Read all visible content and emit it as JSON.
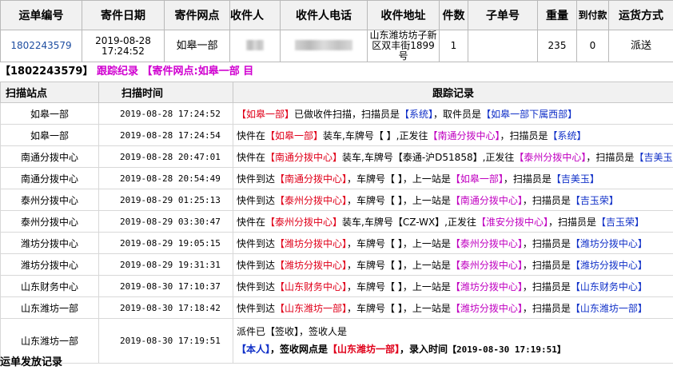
{
  "waybill": {
    "headers": [
      "运单编号",
      "寄件日期",
      "寄件网点",
      "收件人",
      "收件人电话",
      "收件地址",
      "件数",
      "子单号",
      "重量",
      "到付款",
      "运货方式"
    ],
    "row": {
      "waybill_no": "1802243579",
      "send_date": "2019-08-28",
      "send_time": "17:24:52",
      "send_site": "如皋一部",
      "address": "山东潍坊坊子新区双丰街1899号",
      "pieces": "1",
      "sub_no": "",
      "weight": "235",
      "cod": "0",
      "ship_method": "派送"
    }
  },
  "track_head": {
    "bracket_no": "【1802243579】",
    "track_link": "跟踪纪录",
    "site_label": "【寄件网点:如皋一部 目"
  },
  "track": {
    "headers": [
      "扫描站点",
      "扫描时间",
      "跟踪记录"
    ],
    "rows": [
      {
        "site": "如皋一部",
        "time": "2019-08-28 17:24:52",
        "rec": [
          [
            "r",
            "【如皋一部】"
          ],
          [
            "k",
            "已做收件扫描，扫描员是"
          ],
          [
            "b",
            "【系统】"
          ],
          [
            "k",
            "，取件员是"
          ],
          [
            "b",
            "【如皋一部下属西部】"
          ]
        ]
      },
      {
        "site": "如皋一部",
        "time": "2019-08-28 17:24:54",
        "rec": [
          [
            "k",
            "快件在"
          ],
          [
            "r",
            "【如皋一部】"
          ],
          [
            "k",
            "装车,车牌号【 】,正发往"
          ],
          [
            "p",
            "【南通分拨中心】"
          ],
          [
            "k",
            "，扫描员是"
          ],
          [
            "b",
            "【系统】"
          ]
        ]
      },
      {
        "site": "南通分拨中心",
        "time": "2019-08-28 20:47:01",
        "rec": [
          [
            "k",
            "快件在"
          ],
          [
            "r",
            "【南通分拨中心】"
          ],
          [
            "k",
            "装车,车牌号【泰通-沪D51858】,正发往"
          ],
          [
            "p",
            "【泰州分拨中心】"
          ],
          [
            "k",
            "，扫描员是"
          ],
          [
            "b",
            "【吉美玉】"
          ]
        ]
      },
      {
        "site": "南通分拨中心",
        "time": "2019-08-28 20:54:49",
        "rec": [
          [
            "k",
            "快件到达"
          ],
          [
            "r",
            "【南通分拨中心】"
          ],
          [
            "k",
            "，车牌号【 】，上一站是"
          ],
          [
            "p",
            "【如皋一部】"
          ],
          [
            "k",
            "，扫描员是"
          ],
          [
            "b",
            "【吉美玉】"
          ]
        ]
      },
      {
        "site": "泰州分拨中心",
        "time": "2019-08-29 01:25:13",
        "rec": [
          [
            "k",
            "快件到达"
          ],
          [
            "r",
            "【泰州分拨中心】"
          ],
          [
            "k",
            "，车牌号【 】，上一站是"
          ],
          [
            "p",
            "【南通分拨中心】"
          ],
          [
            "k",
            "，扫描员是"
          ],
          [
            "b",
            "【吉玉荣】"
          ]
        ]
      },
      {
        "site": "泰州分拨中心",
        "time": "2019-08-29 03:30:47",
        "rec": [
          [
            "k",
            "快件在"
          ],
          [
            "r",
            "【泰州分拨中心】"
          ],
          [
            "k",
            "装车,车牌号【CZ-WX】,正发往"
          ],
          [
            "p",
            "【淮安分拨中心】"
          ],
          [
            "k",
            "，扫描员是"
          ],
          [
            "b",
            "【吉玉荣】"
          ]
        ]
      },
      {
        "site": "潍坊分拨中心",
        "time": "2019-08-29 19:05:15",
        "rec": [
          [
            "k",
            "快件到达"
          ],
          [
            "r",
            "【潍坊分拨中心】"
          ],
          [
            "k",
            "，车牌号【 】，上一站是"
          ],
          [
            "p",
            "【泰州分拨中心】"
          ],
          [
            "k",
            "，扫描员是"
          ],
          [
            "b",
            "【潍坊分拨中心】"
          ]
        ]
      },
      {
        "site": "潍坊分拨中心",
        "time": "2019-08-29 19:31:31",
        "rec": [
          [
            "k",
            "快件到达"
          ],
          [
            "r",
            "【潍坊分拨中心】"
          ],
          [
            "k",
            "，车牌号【 】，上一站是"
          ],
          [
            "p",
            "【泰州分拨中心】"
          ],
          [
            "k",
            "，扫描员是"
          ],
          [
            "b",
            "【潍坊分拨中心】"
          ]
        ]
      },
      {
        "site": "山东财务中心",
        "time": "2019-08-30 17:10:37",
        "rec": [
          [
            "k",
            "快件到达"
          ],
          [
            "r",
            "【山东财务中心】"
          ],
          [
            "k",
            "，车牌号【 】，上一站是"
          ],
          [
            "p",
            "【潍坊分拨中心】"
          ],
          [
            "k",
            "，扫描员是"
          ],
          [
            "b",
            "【山东财务中心】"
          ]
        ]
      },
      {
        "site": "山东潍坊一部",
        "time": "2019-08-30 17:18:42",
        "rec": [
          [
            "k",
            "快件到达"
          ],
          [
            "r",
            "【山东潍坊一部】"
          ],
          [
            "k",
            "，车牌号【 】，上一站是"
          ],
          [
            "p",
            "【潍坊分拨中心】"
          ],
          [
            "k",
            "，扫描员是"
          ],
          [
            "b",
            "【山东潍坊一部】"
          ]
        ]
      }
    ],
    "last_row": {
      "site": "山东潍坊一部",
      "time": "2019-08-30 17:19:51",
      "line1": "派件已【签收】，签收人是",
      "signer": "【本人】",
      "mid": "，签收网点是",
      "sign_site": "【山东潍坊一部】",
      "entry_label": "，录入时间",
      "entry_time": "【2019-08-30  17:19:51】"
    }
  },
  "dispatch_title": "运单发放记录",
  "colors": {
    "red": "#e0001a",
    "purple": "#c000c0",
    "blue": "#1030c8",
    "link": "#1f4ea1",
    "magenta": "#d000d0"
  }
}
